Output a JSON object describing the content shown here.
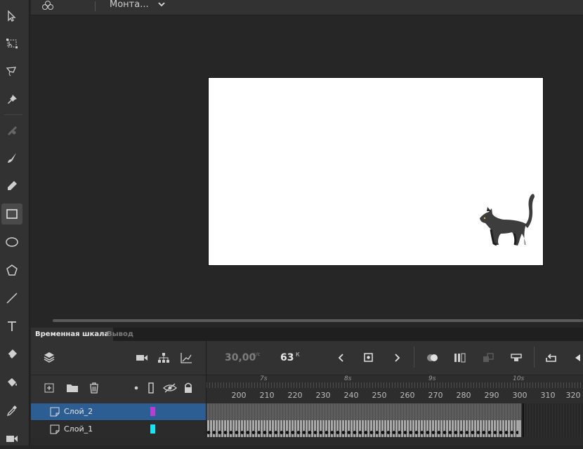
{
  "app": {
    "scene_bar": {
      "scene_name": "Монта...",
      "scene_icon": "clubs-icon"
    },
    "tools": [
      "selection-arrow-icon",
      "free-transform-icon",
      "lasso-icon",
      "pin-icon",
      "asset-warp-icon",
      "brush-icon",
      "pencil-icon",
      "rectangle-icon",
      "oval-icon",
      "polygon-icon",
      "line-icon",
      "text-icon",
      "eraser-icon",
      "paint-bucket-icon",
      "eyedropper-icon",
      "camera-icon"
    ],
    "active_tool": "rectangle-icon"
  },
  "timeline_panel": {
    "tabs": [
      {
        "label": "Временная шкала",
        "active": true
      },
      {
        "label": "Вывод",
        "active": false
      }
    ],
    "fps_value": "30,00",
    "fps_unit": "к/с",
    "current_frame": "63",
    "frame_unit": "К",
    "ruler": {
      "seconds": [
        "7s",
        "8s",
        "9s",
        "10s"
      ],
      "frames": [
        "200",
        "210",
        "220",
        "230",
        "240",
        "250",
        "260",
        "270",
        "280",
        "290",
        "300",
        "310",
        "320"
      ]
    },
    "layers": [
      {
        "name": "Слой_2",
        "color": "#b83dd3",
        "selected": true
      },
      {
        "name": "Слой_1",
        "color": "#19e3f2",
        "selected": false
      }
    ]
  }
}
